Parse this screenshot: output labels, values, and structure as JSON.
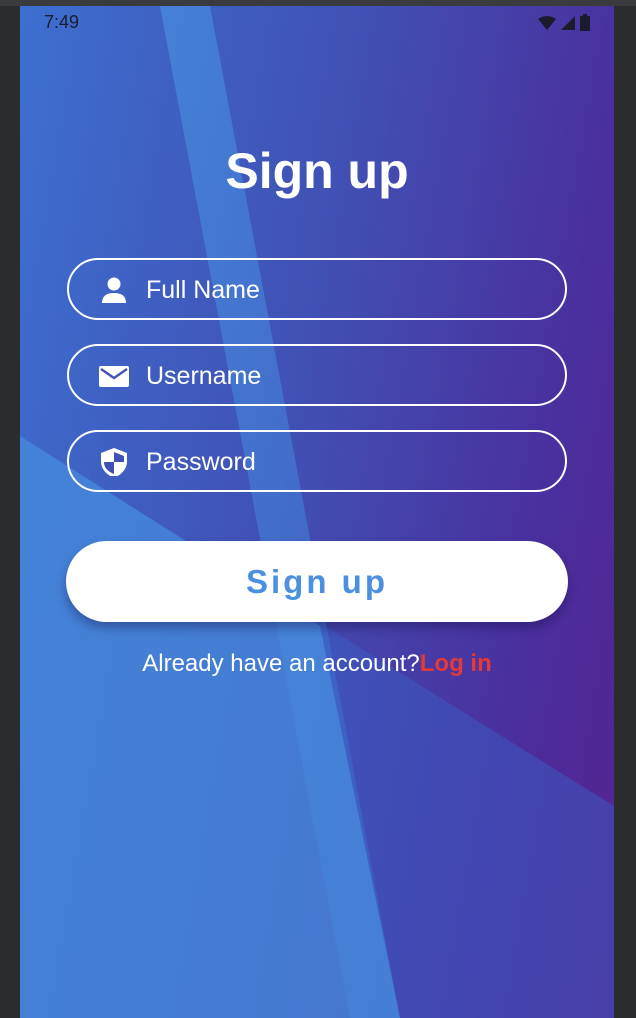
{
  "status_bar": {
    "time": "7:49",
    "icons": [
      "wifi-icon",
      "signal-icon",
      "battery-icon"
    ]
  },
  "screen": {
    "title": "Sign up",
    "fields": [
      {
        "icon": "person-icon",
        "placeholder": "Full Name"
      },
      {
        "icon": "mail-icon",
        "placeholder": "Username"
      },
      {
        "icon": "shield-icon",
        "placeholder": "Password"
      }
    ],
    "submit_label": "Sign up",
    "footer_text": "Already have an account?",
    "login_link": "Log in"
  },
  "colors": {
    "gradient_start": "#3d6fd0",
    "gradient_end": "#55238f",
    "button_background": "#ffffff",
    "button_text": "#4a8fe0",
    "link": "#e53935"
  }
}
